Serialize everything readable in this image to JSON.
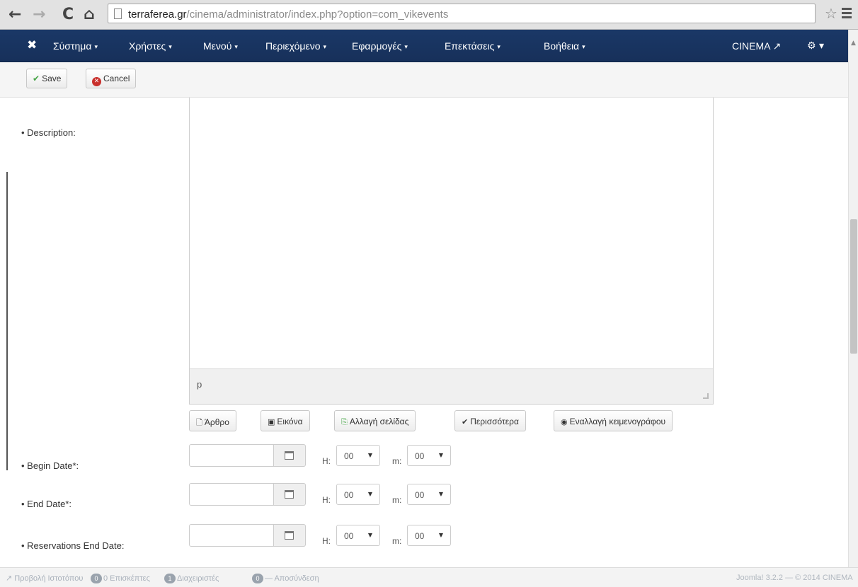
{
  "browser": {
    "back_glyph": "←",
    "forward_glyph": "→",
    "reload_glyph": "C",
    "home_glyph": "⌂",
    "url_domain": "terraferea.gr",
    "url_path": "/cinema/administrator/index.php?option=com_vikevents",
    "star_glyph": "☆"
  },
  "admin_nav": {
    "logo_glyph": "✖",
    "menus": [
      {
        "label": "Σύστημα"
      },
      {
        "label": "Χρήστες"
      },
      {
        "label": "Μενού"
      },
      {
        "label": "Περιεχόμενο"
      },
      {
        "label": "Εφαρμογές"
      },
      {
        "label": "Επεκτάσεις"
      },
      {
        "label": "Βοήθεια"
      }
    ],
    "caret": "▾",
    "site_link": "CINEMA ↗",
    "settings": "⚙ ▾"
  },
  "toolbar": {
    "save_label": "Save",
    "save_glyph": "✔",
    "cancel_label": "Cancel",
    "cancel_glyph": "✕"
  },
  "form": {
    "description_label": "• Description:",
    "editor_path": "p",
    "editor_buttons": [
      {
        "icon": "🗋",
        "label": "Άρθρο"
      },
      {
        "icon": "▣",
        "label": "Εικόνα"
      },
      {
        "icon": "⎘",
        "label": "Αλλαγή σελίδας"
      },
      {
        "icon": "✔",
        "label": "Περισσότερα"
      },
      {
        "icon": "◉",
        "label": "Εναλλαγή κειμενογράφου"
      }
    ],
    "date_rows": [
      {
        "label": "• Begin Date*:",
        "date_value": "",
        "hour_label": "H:",
        "hour": "00",
        "minute_label": "m:",
        "minute": "00"
      },
      {
        "label": "• End Date*:",
        "date_value": "",
        "hour_label": "H:",
        "hour": "00",
        "minute_label": "m:",
        "minute": "00"
      },
      {
        "label": "• Reservations End Date:",
        "date_value": "",
        "hour_label": "H:",
        "hour": "00",
        "minute_label": "m:",
        "minute": "00"
      }
    ],
    "select_arrow": "▼"
  },
  "status_bar": {
    "view_site": "↗ Προβολή Ιστοτόπου",
    "visitors_count": "0",
    "visitors_label": "0 Επισκέπτες",
    "admins_count": "1",
    "admins_label": "Διαχειριστές",
    "messages_count": "0",
    "messages_label": "— Αποσύνδεση",
    "version": "Joomla! 3.2.2 — © 2014 CINEMA"
  },
  "colors": {
    "navbar": "#17305a",
    "save_check": "#46a546",
    "cancel_icon": "#c9302c"
  }
}
